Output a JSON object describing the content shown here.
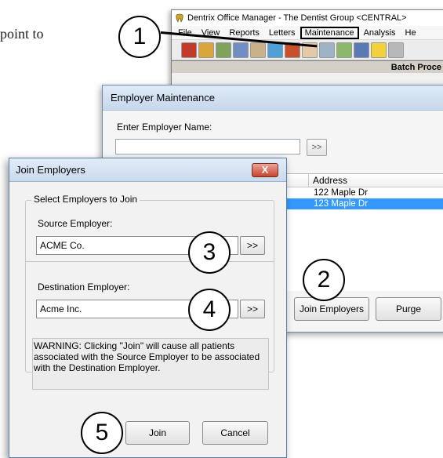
{
  "document": {
    "fragment_text": "point to"
  },
  "office_manager": {
    "title": "Dentrix Office Manager - The Dentist Group <CENTRAL>",
    "menu": [
      "File",
      "View",
      "Reports",
      "Letters",
      "Maintenance",
      "Analysis",
      "He"
    ],
    "batch_label": "Batch Proce"
  },
  "employer_maintenance": {
    "title": "Employer Maintenance",
    "enter_label": "Enter Employer Name:",
    "search_value": "",
    "search_button": ">>",
    "address_header": "Address",
    "rows": [
      "122 Maple Dr",
      "123 Maple Dr"
    ],
    "join_button": "Join Employers",
    "purge_button": "Purge"
  },
  "join_employers": {
    "title": "Join Employers",
    "close_icon": "X",
    "group_label": "Select Employers to Join",
    "source_label": "Source Employer:",
    "source_value": "ACME Co.",
    "source_pick": ">>",
    "destination_label": "Destination Employer:",
    "destination_value": "Acme Inc.",
    "destination_pick": ">>",
    "warning": "WARNING: Clicking \"Join\" will cause all patients associated with the Source Employer to be associated with the Destination Employer.",
    "join_button": "Join",
    "cancel_button": "Cancel"
  },
  "callouts": [
    "1",
    "2",
    "3",
    "4",
    "5"
  ]
}
